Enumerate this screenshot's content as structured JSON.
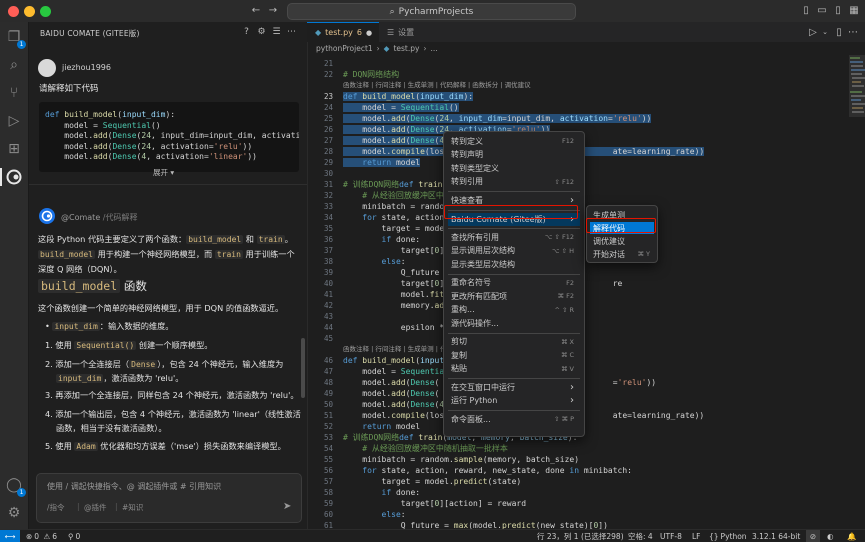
{
  "titlebar": {
    "search_text": "PycharmProjects"
  },
  "activity": {
    "explorer_badge": "1",
    "account_badge": "1"
  },
  "panel": {
    "title": "BAIDU COMATE (GITEE版)",
    "user": {
      "name": "jiezhou1996",
      "message": "请解释如下代码"
    },
    "code_snippet": [
      "def build_model(input_dim):",
      "    model = Sequential()",
      "    model.add(Dense(24, input_dim=input_dim, activation=",
      "    model.add(Dense(24, activation='relu'))",
      "    model.add(Dense(4, activation='linear'))"
    ],
    "expand_label": "展开 ▾",
    "bot": {
      "name": "@Comate",
      "tag": "/代码解释"
    },
    "answer": {
      "intro_1": "这段 Python 代码主要定义了两个函数：",
      "intro_fn1": "build_model",
      "intro_and": " 和 ",
      "intro_fn2": "train",
      "intro_dot": "。",
      "intro_2_code": "build_model",
      "intro_2": " 用于构建一个神经网络模型，而 ",
      "intro_2_code2": "train",
      "intro_2b": " 用于训练一个",
      "intro_3": "深度 Q 网络（DQN）。",
      "heading": "build_model",
      "heading_suffix": " 函数",
      "para": "这个函数创建一个简单的神经网络模型，用于 DQN 的值函数逼近。",
      "bullet_code": "input_dim",
      "bullet_text": "：输入数据的维度。",
      "steps": [
        {
          "n": "1.",
          "a": "使用 ",
          "code": "Sequential()",
          "b": " 创建一个顺序模型。"
        },
        {
          "n": "2.",
          "a": "添加一个全连接层（",
          "code": "Dense",
          "b": "），包含 24 个神经元，输入维度为"
        },
        {
          "n": "",
          "a": "",
          "code": "input_dim",
          "b": "，激活函数为 'relu'。"
        },
        {
          "n": "3.",
          "a": "再添加一个全连接层，同样包含 24 个神经元，激活函数为 'relu'。",
          "code": "",
          "b": ""
        },
        {
          "n": "4.",
          "a": "添加一个输出层，包含 4 个神经元，激活函数为 'linear'（线性激活",
          "code": "",
          "b": ""
        },
        {
          "n": "",
          "a": "函数，相当于没有激活函数）。",
          "code": "",
          "b": ""
        },
        {
          "n": "5.",
          "a": "使用 ",
          "code": "Adam",
          "b": " 优化器和均方误差（'mse'）损失函数来编译模型。"
        }
      ]
    },
    "input": {
      "placeholder": "使用 / 调起快捷指令、@ 调起插件或 # 引用知识",
      "chip_cmd": "/指令",
      "chip_plugin": "@插件",
      "chip_knowledge": "#知识"
    }
  },
  "editor": {
    "tabs": [
      {
        "label": "test.py",
        "badge": "6",
        "active": true
      },
      {
        "label": "设置",
        "active": false
      }
    ],
    "breadcrumb": [
      "pythonProject1",
      "test.py",
      "..."
    ],
    "line_numbers": [
      "21",
      "22",
      "",
      "23",
      "24",
      "25",
      "26",
      "27",
      "28",
      "29",
      "30",
      "31",
      "32",
      "33",
      "34",
      "35",
      "36",
      "37",
      "38",
      "39",
      "40",
      "41",
      "42",
      "43",
      "44",
      "45",
      "",
      "46",
      "47",
      "48",
      "49",
      "50",
      "51",
      "52",
      "53",
      "54",
      "55",
      "56",
      "57",
      "58",
      "59",
      "60",
      "61"
    ],
    "codelens": "函数注释 | 行间注释 | 生成单测 | 代码解释 | 函数拆分 | 调优建议",
    "codelens_short": "函数注释 | 行间注释 | 生成单测 | 代码解释 |"
  },
  "context_menu": {
    "items": [
      {
        "label": "转到定义",
        "shortcut": "F12"
      },
      {
        "label": "转到声明",
        "shortcut": ""
      },
      {
        "label": "转到类型定义",
        "shortcut": ""
      },
      {
        "label": "转到引用",
        "shortcut": "⇧ F12"
      },
      {
        "label": "快速查看",
        "shortcut": "›"
      },
      {
        "label": "Baidu Comate (Gitee版)",
        "shortcut": "›"
      },
      {
        "label": "查找所有引用",
        "shortcut": "⌥ ⇧ F12"
      },
      {
        "label": "显示调用层次结构",
        "shortcut": "⌥ ⇧ H"
      },
      {
        "label": "显示类型层次结构",
        "shortcut": ""
      },
      {
        "label": "重命名符号",
        "shortcut": "F2"
      },
      {
        "label": "更改所有匹配项",
        "shortcut": "⌘ F2"
      },
      {
        "label": "重构...",
        "shortcut": "^ ⇧ R"
      },
      {
        "label": "源代码操作...",
        "shortcut": ""
      },
      {
        "label": "剪切",
        "shortcut": "⌘ X"
      },
      {
        "label": "复制",
        "shortcut": "⌘ C"
      },
      {
        "label": "粘贴",
        "shortcut": "⌘ V"
      },
      {
        "label": "在交互窗口中运行",
        "shortcut": "›"
      },
      {
        "label": "运行 Python",
        "shortcut": "›"
      },
      {
        "label": "命令面板...",
        "shortcut": "⇧ ⌘ P"
      }
    ]
  },
  "submenu": {
    "items": [
      {
        "label": "生成单测",
        "shortcut": ""
      },
      {
        "label": "解释代码",
        "shortcut": ""
      },
      {
        "label": "调优建议",
        "shortcut": ""
      },
      {
        "label": "开始对话",
        "shortcut": "⌘ Y"
      }
    ]
  },
  "statusbar": {
    "errors": "0",
    "warnings": "6",
    "ports": "0",
    "position": "行 23，列 1 (已选择298)",
    "spaces": "空格: 4",
    "encoding": "UTF-8",
    "eol": "LF",
    "language": "Python",
    "interpreter": "3.12.1 64-bit"
  },
  "colors": {
    "accent": "#0078d4",
    "highlight_border": "#e51400",
    "selection": "#264f78"
  }
}
